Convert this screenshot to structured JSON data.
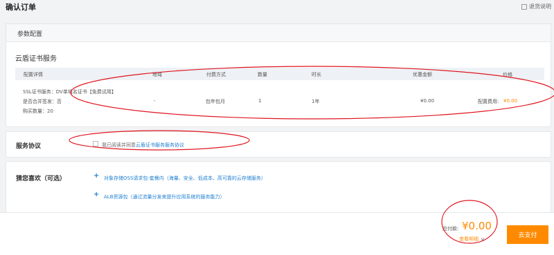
{
  "header": {
    "title": "确认订单",
    "refund_link": "退货说明"
  },
  "config_section": {
    "title": "参数配置",
    "service_name": "云盾证书服务",
    "table": {
      "headers": [
        "配置详情",
        "地域",
        "付费方式",
        "数量",
        "时长",
        "优惠金额",
        "价格"
      ],
      "row": {
        "details": [
          "SSL证书服务：DV单域名证书【免费试用】",
          "是否合并签发：否",
          "购买数量：20"
        ],
        "region": "-",
        "payment": "包年包月",
        "quantity": "1",
        "duration": "1年",
        "discount": "¥0.00",
        "price_label": "配置费用:",
        "price_value": "¥0.00"
      }
    }
  },
  "agreement_section": {
    "title": "服务协议",
    "prefix": "我已阅读并同意",
    "link": "云盾证书服务服务协议"
  },
  "recommend_section": {
    "title": "猜您喜欢（可选）",
    "items": [
      "对象存储OSS请求包-套餐内（海量、安全、低成本、高可靠的云存储服务）",
      "ALB资源包（通过流量分发来提升应用系统的服务能力）"
    ]
  },
  "footer": {
    "pay_label": "应付款:",
    "amount": "¥0.00",
    "detail_link": "查看明细",
    "pay_button": "去支付"
  },
  "colors": {
    "accent_orange": "#ff8a00",
    "link_blue": "#1f7fd1",
    "annotation_red": "#e0141e"
  }
}
